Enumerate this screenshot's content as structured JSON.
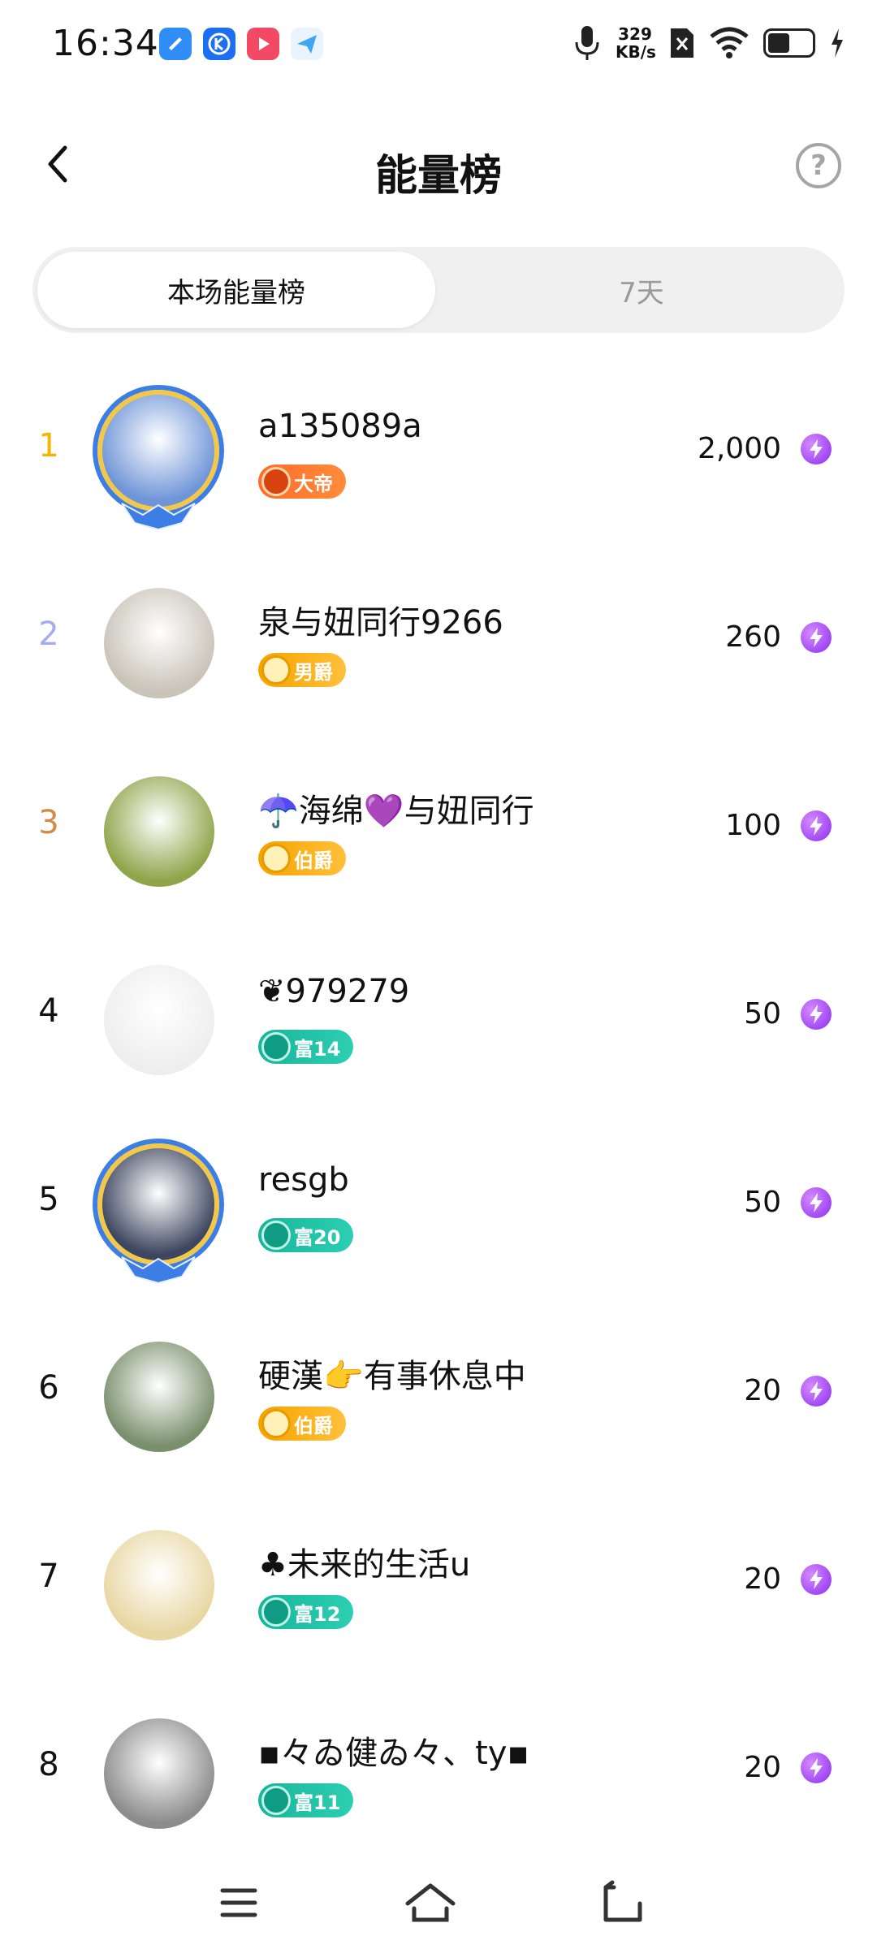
{
  "status": {
    "time": "16:34",
    "speed_value": "329",
    "speed_unit": "KB/s",
    "app_icons": [
      "note-app-icon",
      "k-app-icon",
      "video-app-icon",
      "send-app-icon"
    ],
    "app_colors": [
      "#2f8df5",
      "#1c6ef2",
      "#f24a64",
      "#3fa8f4"
    ]
  },
  "header": {
    "title": "能量榜",
    "help_label": "?"
  },
  "tabs": [
    {
      "label": "本场能量榜",
      "active": true
    },
    {
      "label": "7天",
      "active": false
    }
  ],
  "list": [
    {
      "rank": "1",
      "name": "a135089a",
      "badge": "大帝",
      "badge_type": "emp",
      "score": "2,000",
      "rank_color": "#f4b500",
      "avatar_color": "#6f95d8",
      "framed": true
    },
    {
      "rank": "2",
      "name": "泉与妞同行9266",
      "badge": "男爵",
      "badge_type": "noble",
      "score": "260",
      "rank_color": "#a6acf0",
      "avatar_color": "#c9c3b8",
      "framed": false
    },
    {
      "rank": "3",
      "name": "☂️海绵💜与妞同行",
      "badge": "伯爵",
      "badge_type": "noble",
      "score": "100",
      "rank_color": "#d28a45",
      "avatar_color": "#8fa54a",
      "framed": false
    },
    {
      "rank": "4",
      "name": "❦979279",
      "badge": "富14",
      "badge_type": "rich",
      "score": "50",
      "rank_color": "#111111",
      "avatar_color": "#eeeeee",
      "framed": false
    },
    {
      "rank": "5",
      "name": "resgb",
      "badge": "富20",
      "badge_type": "rich",
      "score": "50",
      "rank_color": "#111111",
      "avatar_color": "#3d4660",
      "framed": true
    },
    {
      "rank": "6",
      "name": "硬漢👉有事休息中",
      "badge": "伯爵",
      "badge_type": "noble",
      "score": "20",
      "rank_color": "#111111",
      "avatar_color": "#7a8f6c",
      "framed": false
    },
    {
      "rank": "7",
      "name": "♣未来的生活u",
      "badge": "富12",
      "badge_type": "rich",
      "score": "20",
      "rank_color": "#111111",
      "avatar_color": "#e8d7a3",
      "framed": false
    },
    {
      "rank": "8",
      "name": "▪々ゐ健ゐ々、ty▪",
      "badge": "富11",
      "badge_type": "rich",
      "score": "20",
      "rank_color": "#111111",
      "avatar_color": "#8c8c8c",
      "framed": false
    }
  ],
  "navbar": {
    "icons": [
      "menu-icon",
      "home-icon",
      "back-nav-icon"
    ]
  }
}
